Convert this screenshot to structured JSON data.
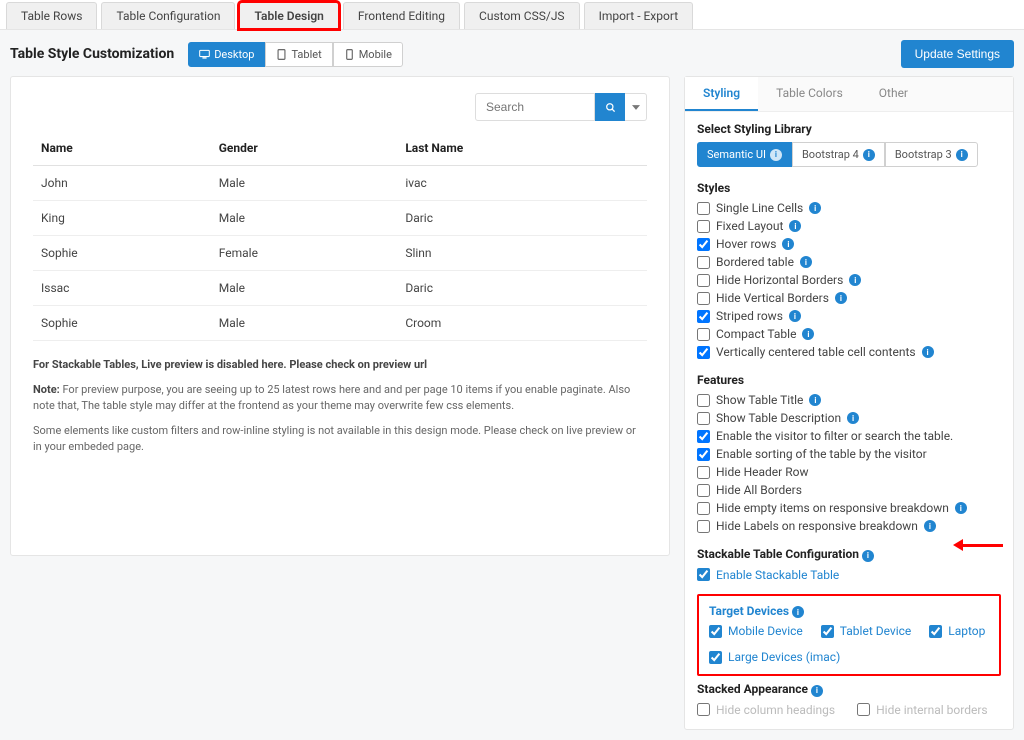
{
  "top_tabs": [
    "Table Rows",
    "Table Configuration",
    "Table Design",
    "Frontend Editing",
    "Custom CSS/JS",
    "Import - Export"
  ],
  "top_tabs_active_index": 2,
  "page_title": "Table Style Customization",
  "device_tabs": {
    "desktop": "Desktop",
    "tablet": "Tablet",
    "mobile": "Mobile"
  },
  "update_btn": "Update Settings",
  "search": {
    "placeholder": "Search"
  },
  "table": {
    "columns": [
      "Name",
      "Gender",
      "Last Name"
    ],
    "rows": [
      [
        "John",
        "Male",
        "ivac"
      ],
      [
        "King",
        "Male",
        "Daric"
      ],
      [
        "Sophie",
        "Female",
        "Slinn"
      ],
      [
        "Issac",
        "Male",
        "Daric"
      ],
      [
        "Sophie",
        "Male",
        "Croom"
      ]
    ]
  },
  "notes": {
    "line1": "For Stackable Tables, Live preview is disabled here. Please check on preview url",
    "note_label": "Note:",
    "note_body": " For preview purpose, you are seeing up to 25 latest rows here and and per page 10 items if you enable paginate. Also note that, The table style may differ at the frontend as your theme may overwrite few css elements.",
    "line3": "Some elements like custom filters and row-inline styling is not available in this design mode. Please check on live preview or in your embeded page."
  },
  "right_tabs": {
    "styling": "Styling",
    "colors": "Table Colors",
    "other": "Other"
  },
  "styling_library": {
    "heading": "Select Styling Library",
    "options": [
      "Semantic UI",
      "Bootstrap 4",
      "Bootstrap 3"
    ]
  },
  "styles": {
    "heading": "Styles",
    "items": [
      {
        "label": "Single Line Cells",
        "checked": false
      },
      {
        "label": "Fixed Layout",
        "checked": false
      },
      {
        "label": "Hover rows",
        "checked": true
      },
      {
        "label": "Bordered table",
        "checked": false
      },
      {
        "label": "Hide Horizontal Borders",
        "checked": false
      },
      {
        "label": "Hide Vertical Borders",
        "checked": false
      },
      {
        "label": "Striped rows",
        "checked": true
      },
      {
        "label": "Compact Table",
        "checked": false
      },
      {
        "label": "Vertically centered table cell contents",
        "checked": true
      }
    ]
  },
  "features": {
    "heading": "Features",
    "items": [
      {
        "label": "Show Table Title",
        "checked": false,
        "info": true
      },
      {
        "label": "Show Table Description",
        "checked": false,
        "info": true
      },
      {
        "label": "Enable the visitor to filter or search the table.",
        "checked": true,
        "info": false
      },
      {
        "label": "Enable sorting of the table by the visitor",
        "checked": true,
        "info": false
      },
      {
        "label": "Hide Header Row",
        "checked": false,
        "info": false
      },
      {
        "label": "Hide All Borders",
        "checked": false,
        "info": false
      },
      {
        "label": "Hide empty items on responsive breakdown",
        "checked": false,
        "info": true
      },
      {
        "label": "Hide Labels on responsive breakdown",
        "checked": false,
        "info": true
      }
    ]
  },
  "stackable": {
    "heading": "Stackable Table Configuration",
    "enable_label": "Enable Stackable Table"
  },
  "target_devices": {
    "heading": "Target Devices",
    "items": [
      "Mobile Device",
      "Tablet Device",
      "Laptop",
      "Large Devices (imac)"
    ]
  },
  "stacked_appearance": {
    "heading": "Stacked Appearance",
    "col_headings": "Hide column headings",
    "internal_borders": "Hide internal borders"
  }
}
